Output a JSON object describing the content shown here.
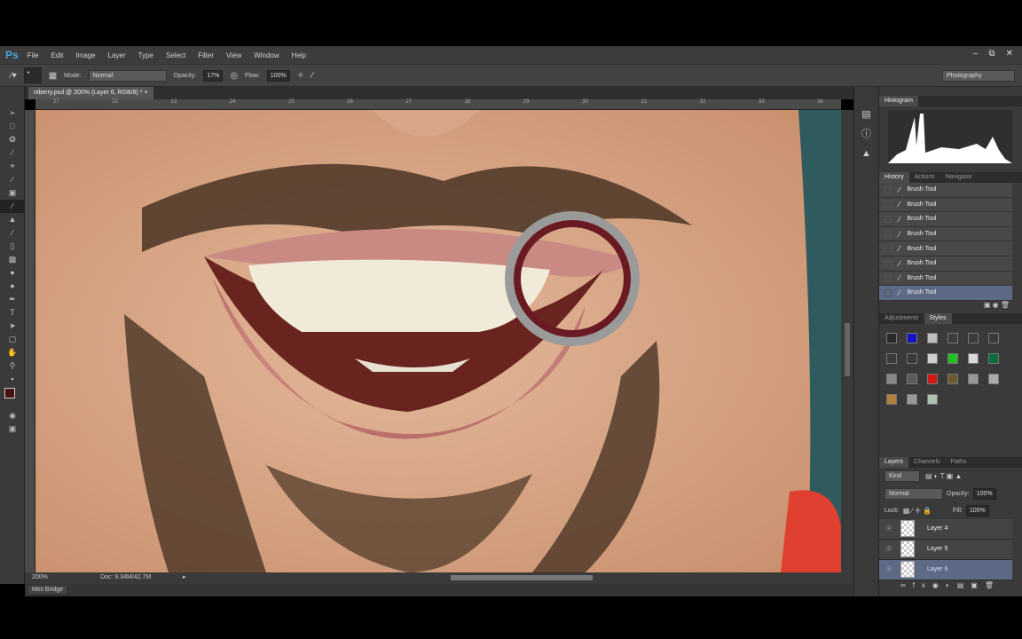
{
  "app": {
    "logo": "Ps",
    "menu": [
      "File",
      "Edit",
      "Image",
      "Layer",
      "Type",
      "Select",
      "Filter",
      "View",
      "Window",
      "Help"
    ],
    "window_controls": [
      "minimize",
      "restore",
      "close"
    ]
  },
  "options": {
    "mode_label": "Mode:",
    "mode_value": "Normal",
    "opacity_label": "Opacity:",
    "opacity_value": "17%",
    "flow_label": "Flow:",
    "flow_value": "100%",
    "workspace": "Photography"
  },
  "document": {
    "tab_title": "niberry.psd @ 200% (Layer 6, RGB/8) *",
    "zoom": "200%",
    "doc_size": "Doc: 9.34M/42.7M",
    "ruler_ticks": [
      "27",
      "22",
      "23",
      "24",
      "25",
      "26",
      "27",
      "28",
      "29",
      "30",
      "31",
      "32",
      "33",
      "34"
    ]
  },
  "mini_bridge": "Mini Bridge",
  "histogram": {
    "tab": "Histogram"
  },
  "history": {
    "tabs": [
      "History",
      "Actions",
      "Navigator"
    ],
    "items": [
      "Brush Tool",
      "Brush Tool",
      "Brush Tool",
      "Brush Tool",
      "Brush Tool",
      "Brush Tool",
      "Brush Tool",
      "Brush Tool"
    ],
    "selected_index": 7
  },
  "styles": {
    "tabs": [
      "Adjustments",
      "Styles"
    ],
    "swatches": [
      "#2a2a2a",
      "#1515c0",
      "#bdbdbd",
      "#3c3c3c",
      "#3a3a3a",
      "#3a3a3a",
      "#3a3a3a",
      "#3a3a3a",
      "#d0d0d0",
      "#22c022",
      "#d8d8d8",
      "#0b6b3a",
      "#888",
      "#5a5a5a",
      "#d01818",
      "#6a5a30",
      "#999",
      "#aaa",
      "#b08040",
      "#999",
      "#b0c0b0"
    ]
  },
  "layers": {
    "tabs": [
      "Layers",
      "Channels",
      "Paths"
    ],
    "filter": "Kind",
    "blend": "Normal",
    "opacity_label": "Opacity:",
    "opacity": "100%",
    "lock_label": "Lock:",
    "fill_label": "Fill:",
    "fill": "100%",
    "items": [
      "Layer 4",
      "Layer 5",
      "Layer 6"
    ],
    "selected": "Layer 6"
  }
}
